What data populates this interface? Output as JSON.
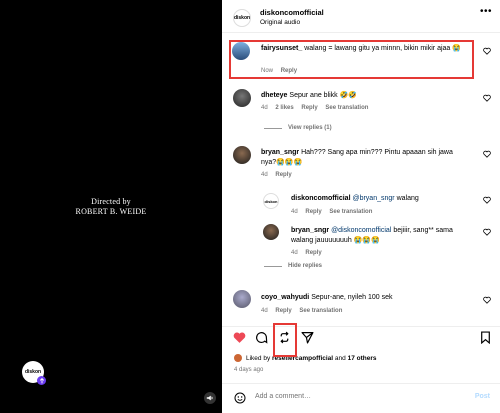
{
  "video": {
    "directed_line1": "Directed by",
    "directed_line2": "ROBERT B. WEIDE",
    "logo_text": "diskon"
  },
  "post": {
    "account": "diskoncomofficial",
    "audio": "Original audio",
    "logo_text": "diskon"
  },
  "comments": [
    {
      "user": "fairysunset_",
      "text": "walang = lawang gitu ya minnn, bikin mikir ajaa 😭",
      "time": "Now",
      "reply": "Reply"
    },
    {
      "user": "dheteye",
      "text": "Sepur ane blikk 🤣🤣",
      "time": "4d",
      "likes": "2 likes",
      "reply": "Reply",
      "translate": "See translation",
      "replies_toggle": "View replies (1)"
    },
    {
      "user": "bryan_sngr",
      "text": "Hah??? Sang apa min??? Pintu apaaan sih jawa nya?😭😭😭",
      "time": "4d",
      "reply": "Reply",
      "replies_toggle": "Hide replies",
      "replies": [
        {
          "user": "diskoncomofficial",
          "mention": "@bryan_sngr",
          "text": "walang",
          "time": "4d",
          "reply": "Reply",
          "translate": "See translation"
        },
        {
          "user": "bryan_sngr",
          "mention": "@diskoncomofficial",
          "text": "bejiiir, sang** sama walang jauuuuuuuh 😭😭😭",
          "time": "4d",
          "reply": "Reply"
        }
      ]
    },
    {
      "user": "coyo_wahyudi",
      "text": "Sepur-ane, nyileh 100 sek",
      "time": "4d",
      "reply": "Reply",
      "translate": "See translation"
    }
  ],
  "likes": {
    "prefix": "Liked by",
    "user": "resellercampofficial",
    "middle": "and",
    "others": "17 others"
  },
  "timestamp": "4 days ago",
  "comment_input": {
    "placeholder": "Add a comment…",
    "post_label": "Post"
  },
  "colors": {
    "highlight": "#e53935",
    "like_red": "#ed4956",
    "mention": "#00376b"
  }
}
